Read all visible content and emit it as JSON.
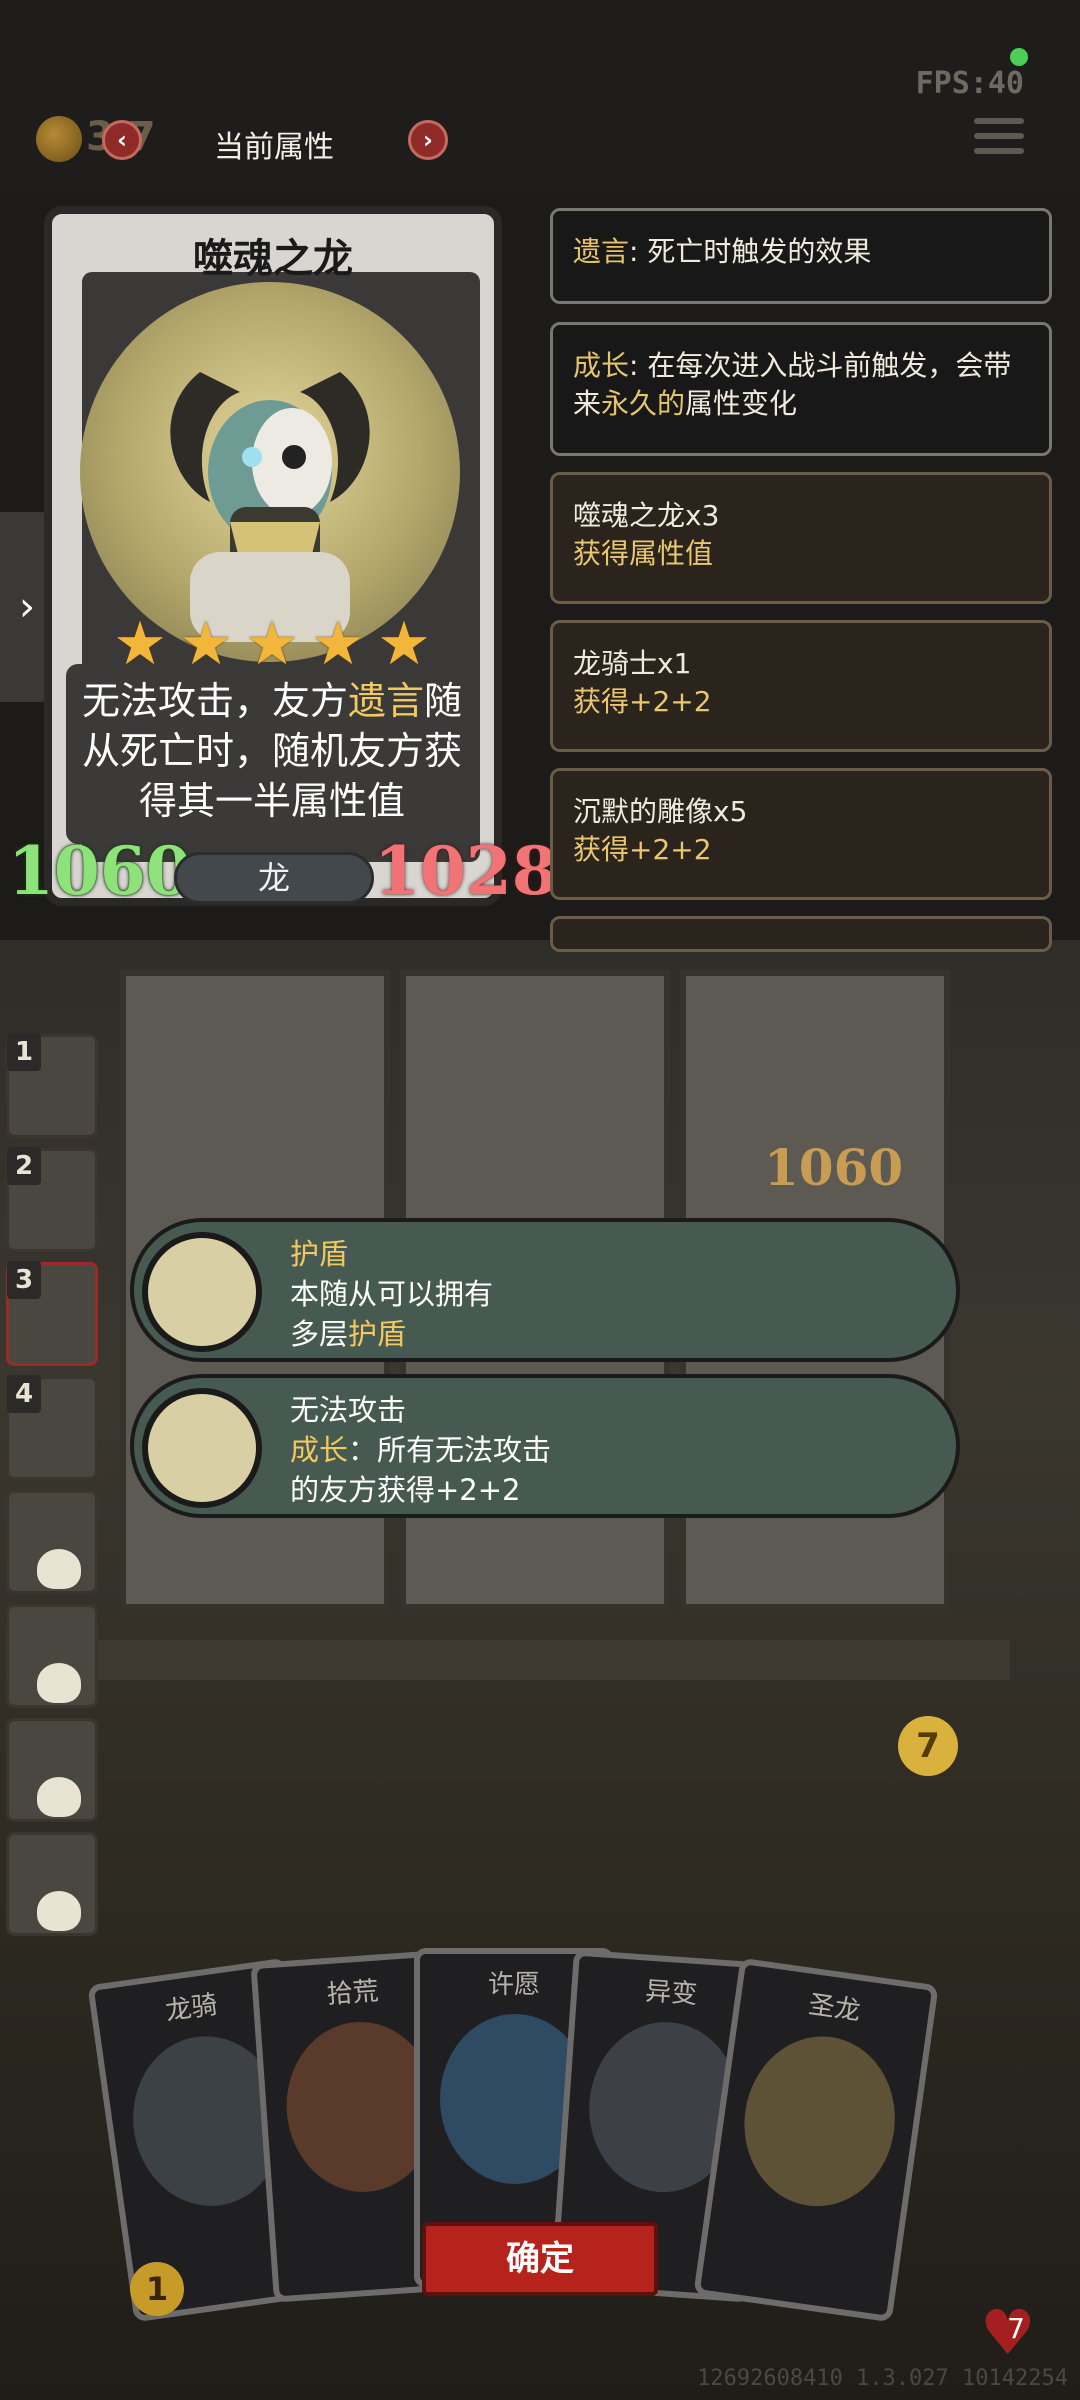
{
  "status": {
    "fps": "FPS:40"
  },
  "topbar": {
    "gold": "3  7",
    "title": "当前属性",
    "prev_icon": "chevron-left-icon",
    "next_icon": "chevron-right-icon",
    "menu_icon": "hamburger-menu-icon"
  },
  "card": {
    "name": "噬魂之龙",
    "stars": 5,
    "desc_1": "无法攻击，友方",
    "desc_kw": "遗言",
    "desc_2": "随从死亡时，随机友方获得其一半属性值",
    "attack": "1060",
    "health": "1028",
    "tribe": "龙"
  },
  "panels": {
    "deathrattle_kw": "遗言",
    "deathrattle_text": ": 死亡时触发的效果",
    "growth_kw": "成长",
    "growth_text_1": ": 在每次进入战斗前触发，会带来",
    "growth_kw2": "永久的",
    "growth_text_2": "属性变化",
    "row1_title": "噬魂之龙x3",
    "row1_sub": "获得属性值",
    "row2_title": "龙骑士x1",
    "row2_sub": "获得+2+2",
    "row3_title": "沉默的雕像x5",
    "row3_sub": "获得+2+2"
  },
  "roster": {
    "slot1": "1",
    "slot2": "2",
    "slot3": "3",
    "slot4": "4"
  },
  "tooltips": {
    "shield_title": "护盾",
    "shield_line1": "本随从可以拥有",
    "shield_line2_a": "多层",
    "shield_line2_kw": "护盾",
    "noattack_title": "无法攻击",
    "noattack_kw": "成长",
    "noattack_line1": "：所有无法攻击",
    "noattack_line2": "的友方获得+2+2"
  },
  "board": {
    "hp": "1060",
    "badge": "7"
  },
  "hand": [
    {
      "name": "龙骑"
    },
    {
      "name": "拾荒"
    },
    {
      "name": "许愿"
    },
    {
      "name": "异变"
    },
    {
      "name": "圣龙"
    }
  ],
  "confirm_label": "确定",
  "footer": {
    "id": "12692608410 1.3.027 10142254",
    "heart": "7",
    "chest": "1"
  },
  "colors": {
    "gold_text": "#f1c95f",
    "attack": "#8ee27a",
    "health": "#f27376",
    "confirm": "#b6231d"
  }
}
